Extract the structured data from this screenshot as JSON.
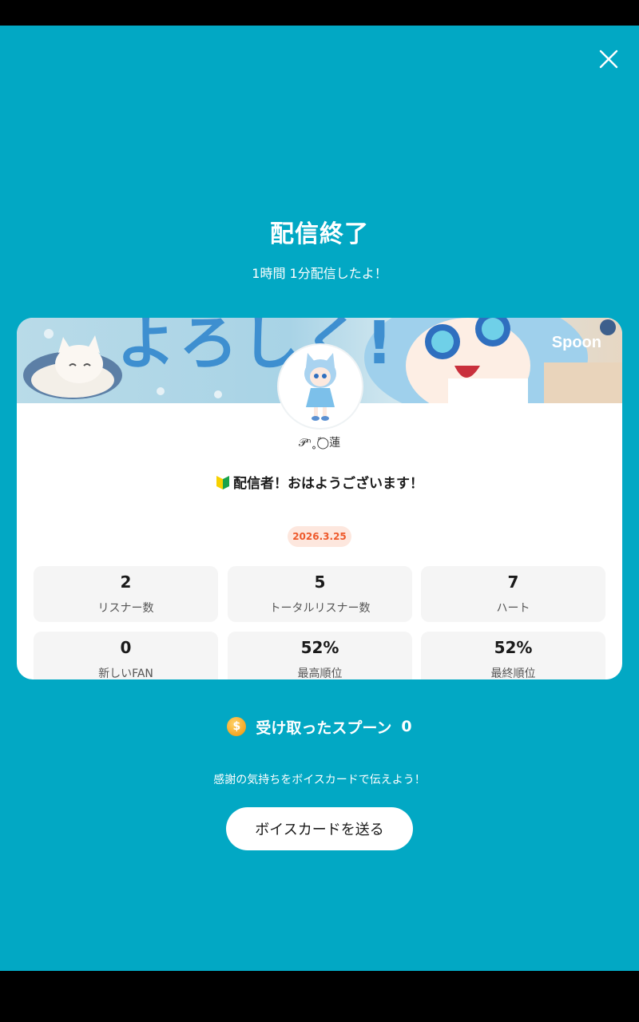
{
  "header": {
    "title": "配信終了",
    "duration_text": "1時間 1分配信したよ！"
  },
  "card": {
    "banner_text": "よろしく!",
    "banner_brand": "Spoon",
    "nickname": "𝒫ⁿ˳◯ً蓮",
    "stream_title_icon": "beginner-mark-icon",
    "stream_title": "配信者！おはようございます！",
    "date": "2026.3.25",
    "stats": [
      {
        "value": "2",
        "label": "リスナー数"
      },
      {
        "value": "5",
        "label": "トータルリスナー数"
      },
      {
        "value": "7",
        "label": "ハート"
      },
      {
        "value": "0",
        "label": "新しいFAN"
      },
      {
        "value": "52%",
        "label": "最高順位"
      },
      {
        "value": "52%",
        "label": "最終順位"
      }
    ]
  },
  "spoons": {
    "label": "受け取ったスプーン",
    "count": "0",
    "icon": "coin-icon"
  },
  "thanks_text": "感謝の気持ちをボイスカードで伝えよう！",
  "voice_card_button": "ボイスカードを送る",
  "colors": {
    "background": "#02a8c4",
    "date_badge_bg": "#fde7de",
    "date_badge_text": "#ee5a2c"
  }
}
